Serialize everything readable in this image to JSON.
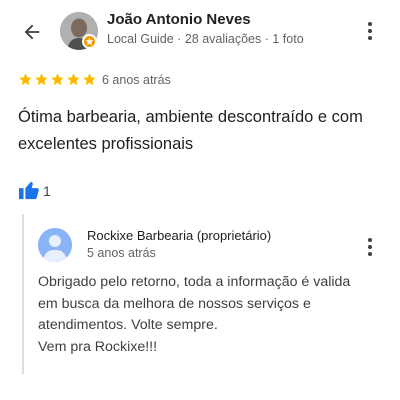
{
  "review": {
    "author_name": "João Antonio Neves",
    "author_meta": "Local Guide · 28 avaliações · 1 foto",
    "rating": 5,
    "rating_max": 5,
    "time_ago": "6 anos atrás",
    "text": "Ótima barbearia, ambiente descontraído e com excelentes profissionais",
    "likes": "1"
  },
  "owner_reply": {
    "name": "Rockixe Barbearia (proprietário)",
    "time_ago": "5 anos atrás",
    "lines": [
      "Obrigado pelo retorno, toda a informação é valida",
      "em busca da melhora de nossos serviços e",
      "atendimentos. Volte sempre.",
      "Vem pra Rockixe!!!"
    ]
  },
  "icons": {
    "back": "arrow-back-icon",
    "more": "more-vert-icon",
    "star": "star-icon",
    "like": "thumb-up-icon",
    "badge": "local-guide-badge-icon"
  },
  "colors": {
    "star": "#fbbc04",
    "like": "#1a73e8",
    "badge": "#f29900",
    "owner_avatar": "#8ab4f8",
    "text_primary": "#202124",
    "text_secondary": "#5f6368"
  }
}
